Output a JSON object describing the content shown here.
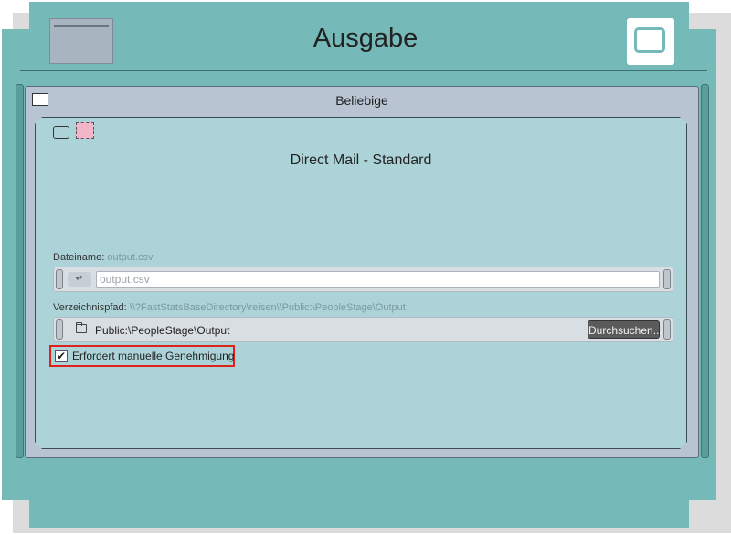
{
  "window": {
    "title": "Ausgabe"
  },
  "icons": {
    "app": "app-thumbnail-icon",
    "corner": "window-frame-icon",
    "folder": "folder-icon",
    "return": "return-arrow-icon",
    "check": "checkmark-icon"
  },
  "panel": {
    "title": "Beliebige",
    "section_title": "Direct Mail - Standard",
    "filename": {
      "label": "Dateiname:",
      "value": "output.csv",
      "input_value": "output.csv",
      "icon_glyph": "↵"
    },
    "directory": {
      "label": "Verzeichnispfad:",
      "value": "\\\\?FastStatsBaseDirectory\\reisen\\\\Public:\\PeopleStage\\Output",
      "path": "Public:\\PeopleStage\\Output",
      "browse_label": "Durchsuchen..."
    },
    "approval": {
      "label": "Erfordert manuelle Genehmigung",
      "checked": true,
      "check_glyph": "✔"
    }
  },
  "colors": {
    "background": "#75b9b8",
    "panel": "#b8c4d2",
    "inner": "#acd3d8",
    "highlight": "#e0201a"
  }
}
